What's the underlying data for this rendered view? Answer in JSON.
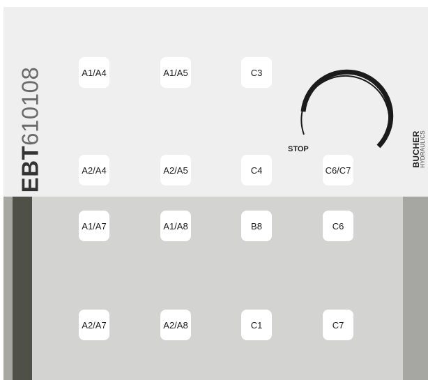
{
  "panel": {
    "model_prefix": "EBT",
    "model_number": "610108",
    "stop_label": "STOP",
    "brand": {
      "name": "BUCHER",
      "sub": "HYDRAULICS"
    },
    "colors": {
      "upper_bg": "#efefef",
      "lower_bg": "#d3d3d1",
      "dark_strip": "#4f5048",
      "side_strip": "#a6a7a2",
      "key_bg": "#ffffff",
      "dial": "#1b1b1b"
    }
  },
  "keys": [
    {
      "id": "a1a4",
      "label": "A1/A4"
    },
    {
      "id": "a1a5",
      "label": "A1/A5"
    },
    {
      "id": "c3",
      "label": "C3"
    },
    {
      "id": "a2a4",
      "label": "A2/A4"
    },
    {
      "id": "a2a5",
      "label": "A2/A5"
    },
    {
      "id": "c4",
      "label": "C4"
    },
    {
      "id": "c6c7",
      "label": "C6/C7"
    },
    {
      "id": "a1a7",
      "label": "A1/A7"
    },
    {
      "id": "a1a8",
      "label": "A1/A8"
    },
    {
      "id": "b8",
      "label": "B8"
    },
    {
      "id": "c6",
      "label": "C6"
    },
    {
      "id": "a2a7",
      "label": "A2/A7"
    },
    {
      "id": "a2a8",
      "label": "A2/A8"
    },
    {
      "id": "c1",
      "label": "C1"
    },
    {
      "id": "c7",
      "label": "C7"
    }
  ]
}
